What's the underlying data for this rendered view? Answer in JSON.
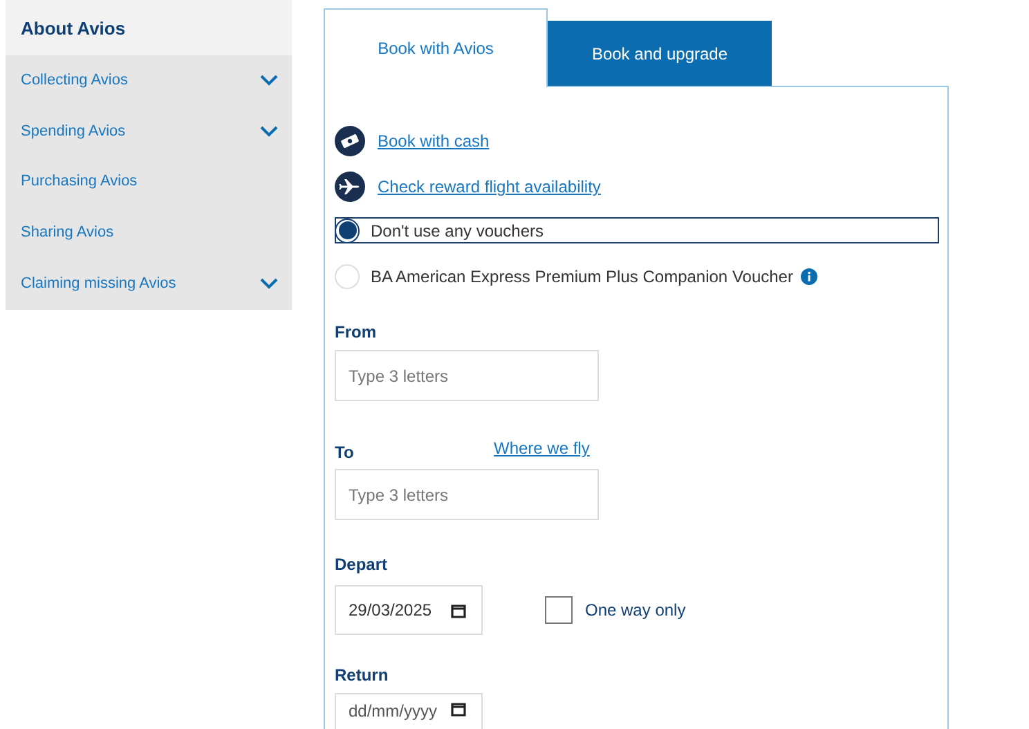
{
  "sidebar": {
    "title": "About Avios",
    "items": [
      {
        "label": "Collecting Avios",
        "expandable": true
      },
      {
        "label": "Spending Avios",
        "expandable": true
      },
      {
        "label": "Purchasing Avios",
        "expandable": false
      },
      {
        "label": "Sharing Avios",
        "expandable": false
      },
      {
        "label": "Claiming missing Avios",
        "expandable": true
      }
    ]
  },
  "tabs": [
    {
      "label": "Book with Avios",
      "selected": true
    },
    {
      "label": "Book and upgrade",
      "selected": false
    }
  ],
  "links": [
    {
      "label": "Book with cash",
      "kind": "cash"
    },
    {
      "label": "Check reward flight availability",
      "kind": "plane"
    }
  ],
  "vouchers": [
    {
      "label": "Don't use any vouchers",
      "selected": true,
      "info": false
    },
    {
      "label": "BA American Express Premium Plus Companion Voucher",
      "selected": false,
      "info": true
    }
  ],
  "from": {
    "label": "From",
    "placeholder": "Type 3 letters"
  },
  "to": {
    "label": "To",
    "link": "Where we fly",
    "placeholder": "Type 3 letters"
  },
  "depart": {
    "label": "Depart",
    "value": "29/03/2025"
  },
  "one_way": {
    "label": "One way only",
    "checked": false
  },
  "return": {
    "label": "Return",
    "placeholder": "dd/mm/yyyy"
  }
}
